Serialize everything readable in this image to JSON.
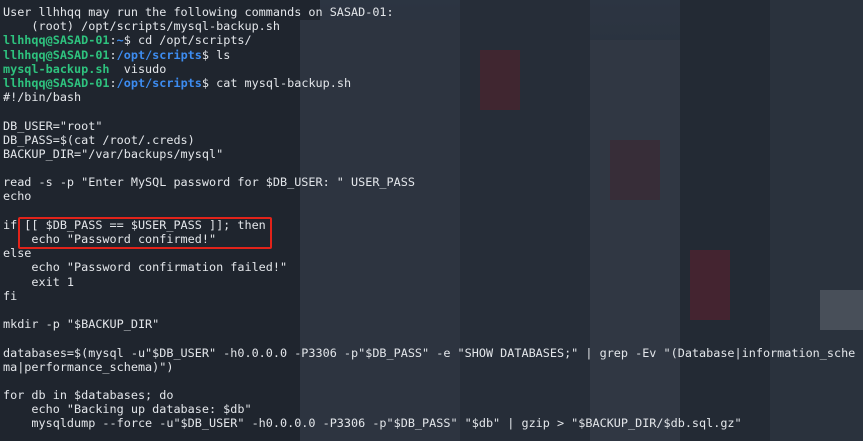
{
  "terminal": {
    "lines": [
      {
        "type": "out",
        "text": "User llhhqq may run the following commands on SASAD-01:"
      },
      {
        "type": "out",
        "text": "    (root) /opt/scripts/mysql-backup.sh"
      },
      {
        "type": "prompt",
        "user": "llhhqq@SASAD-01",
        "sep": ":",
        "path": "~",
        "sym": "$ ",
        "cmd": "cd /opt/scripts/"
      },
      {
        "type": "prompt",
        "user": "llhhqq@SASAD-01",
        "sep": ":",
        "path": "/opt/scripts",
        "sym": "$ ",
        "cmd": "ls"
      },
      {
        "type": "ls",
        "exe": "mysql-backup.sh",
        "rest": "  visudo"
      },
      {
        "type": "prompt",
        "user": "llhhqq@SASAD-01",
        "sep": ":",
        "path": "/opt/scripts",
        "sym": "$ ",
        "cmd": "cat mysql-backup.sh"
      },
      {
        "type": "out",
        "text": "#!/bin/bash"
      },
      {
        "type": "out",
        "text": ""
      },
      {
        "type": "out",
        "text": "DB_USER=\"root\""
      },
      {
        "type": "out",
        "text": "DB_PASS=$(cat /root/.creds)"
      },
      {
        "type": "out",
        "text": "BACKUP_DIR=\"/var/backups/mysql\""
      },
      {
        "type": "out",
        "text": ""
      },
      {
        "type": "out",
        "text": "read -s -p \"Enter MySQL password for $DB_USER: \" USER_PASS"
      },
      {
        "type": "out",
        "text": "echo"
      },
      {
        "type": "out",
        "text": ""
      },
      {
        "type": "out",
        "text": "if [[ $DB_PASS == $USER_PASS ]]; then"
      },
      {
        "type": "out",
        "text": "    echo \"Password confirmed!\""
      },
      {
        "type": "out",
        "text": "else"
      },
      {
        "type": "out",
        "text": "    echo \"Password confirmation failed!\""
      },
      {
        "type": "out",
        "text": "    exit 1"
      },
      {
        "type": "out",
        "text": "fi"
      },
      {
        "type": "out",
        "text": ""
      },
      {
        "type": "out",
        "text": "mkdir -p \"$BACKUP_DIR\""
      },
      {
        "type": "out",
        "text": ""
      },
      {
        "type": "out",
        "text": "databases=$(mysql -u\"$DB_USER\" -h0.0.0.0 -P3306 -p\"$DB_PASS\" -e \"SHOW DATABASES;\" | grep -Ev \"(Database|information_sche"
      },
      {
        "type": "out",
        "text": "ma|performance_schema)\")"
      },
      {
        "type": "out",
        "text": ""
      },
      {
        "type": "out",
        "text": "for db in $databases; do"
      },
      {
        "type": "out",
        "text": "    echo \"Backing up database: $db\""
      },
      {
        "type": "out",
        "text": "    mysqldump --force -u\"$DB_USER\" -h0.0.0.0 -P3306 -p\"$DB_PASS\" \"$db\" | gzip > \"$BACKUP_DIR/$db.sql.gz\""
      }
    ]
  },
  "colors": {
    "prompt_user": "#2ec27e",
    "prompt_path": "#3d8cf0",
    "text": "#e3e6ea",
    "highlight_box": "#e2231a"
  }
}
